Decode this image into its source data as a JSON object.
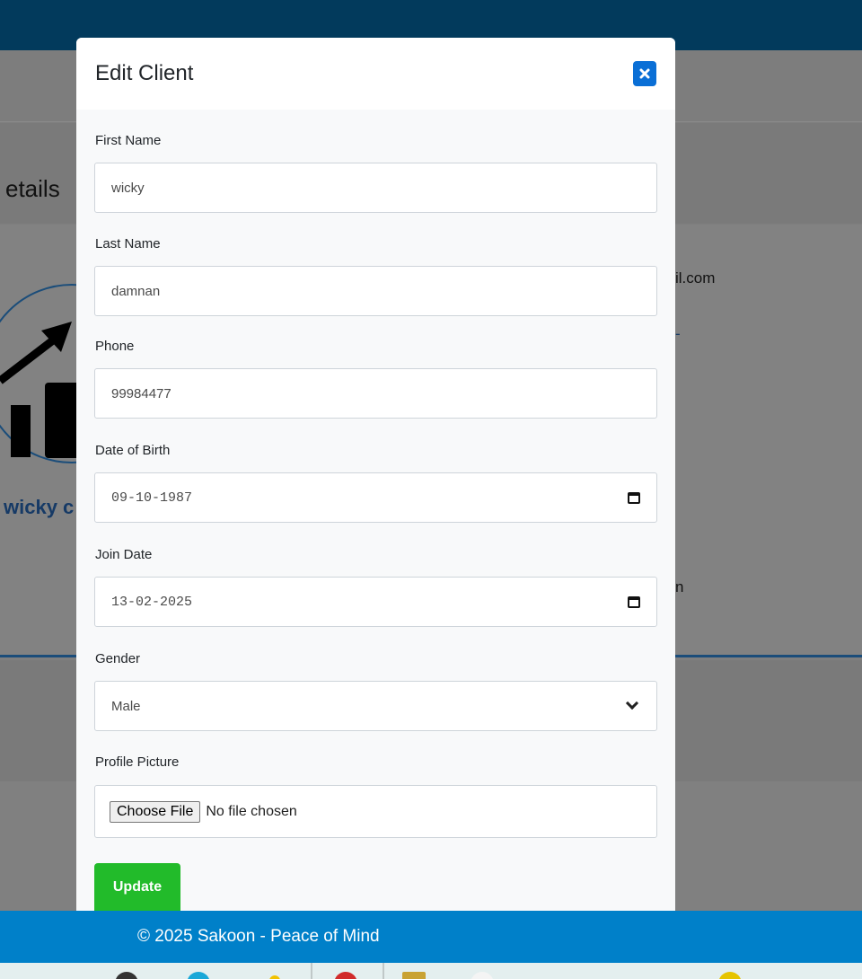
{
  "background": {
    "heading_fragment": "etails",
    "name_fragment": "wicky c",
    "email_fragment": "il.com",
    "text_fragment_1": "-",
    "text_fragment_2": "n"
  },
  "modal": {
    "title": "Edit Client",
    "close_icon": "close-icon",
    "fields": {
      "first_name": {
        "label": "First Name",
        "value": "wicky"
      },
      "last_name": {
        "label": "Last Name",
        "value": "damnan"
      },
      "phone": {
        "label": "Phone",
        "value": "99984477"
      },
      "dob": {
        "label": "Date of Birth",
        "value": "09-10-1987"
      },
      "join_date": {
        "label": "Join Date",
        "value": "13-02-2025"
      },
      "gender": {
        "label": "Gender",
        "value": "Male"
      },
      "picture": {
        "label": "Profile Picture",
        "button": "Choose File",
        "status": "No file chosen"
      }
    },
    "update_label": "Update"
  },
  "footer": {
    "text": "© 2025 Sakoon - Peace of Mind"
  },
  "colors": {
    "header": "#023a5c",
    "footer": "#0080c9",
    "primary": "#0a6fd6",
    "success": "#22bb2a"
  }
}
